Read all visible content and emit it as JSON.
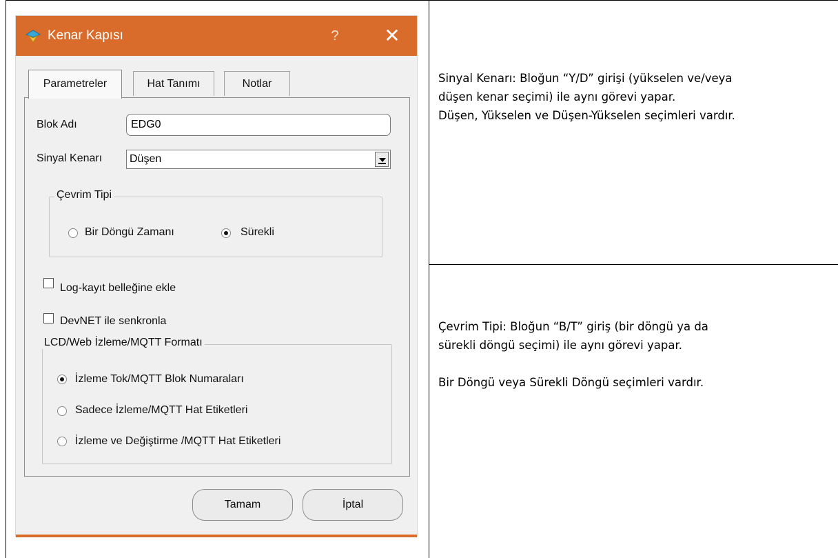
{
  "dialog": {
    "title": "Kenar Kapısı",
    "help_label": "?",
    "close_label": "✕",
    "tabs": [
      {
        "label": "Parametreler",
        "active": true
      },
      {
        "label": "Hat Tanımı",
        "active": false
      },
      {
        "label": "Notlar",
        "active": false
      }
    ],
    "block_name": {
      "label": "Blok Adı",
      "value": "EDG0"
    },
    "signal_edge": {
      "label": "Sinyal Kenarı",
      "value": "Düşen"
    },
    "cycle_type": {
      "title": "Çevrim Tipi",
      "options": [
        {
          "label": "Bir Döngü Zamanı",
          "checked": false
        },
        {
          "label": "Sürekli",
          "checked": true
        }
      ]
    },
    "checkboxes": [
      {
        "label": "Log-kayıt belleğine ekle",
        "checked": false
      },
      {
        "label": "DevNET ile senkronla",
        "checked": false
      }
    ],
    "format_group": {
      "title": "LCD/Web İzleme/MQTT Formatı",
      "options": [
        {
          "label": "İzleme Tok/MQTT Blok Numaraları",
          "checked": true
        },
        {
          "label": "Sadece İzleme/MQTT Hat Etiketleri",
          "checked": false
        },
        {
          "label": "İzleme ve Değiştirme /MQTT Hat Etiketleri",
          "checked": false
        }
      ]
    },
    "ok_label": "Tamam",
    "cancel_label": "İptal",
    "accent_color": "#d96c2b"
  },
  "notes": {
    "top": [
      "Sinyal Kenarı:  Bloğun “Y/D” girişi (yükselen ve/veya",
      "düşen kenar seçimi) ile aynı görevi yapar.",
      "Düşen, Yükselen ve Düşen-Yükselen seçimleri vardır."
    ],
    "bottom": [
      "Çevrim Tipi:  Bloğun “B/T” giriş (bir döngü ya da",
      "sürekli döngü seçimi) ile aynı görevi yapar.",
      "Bir Döngü veya Sürekli Döngü seçimleri vardır."
    ]
  }
}
